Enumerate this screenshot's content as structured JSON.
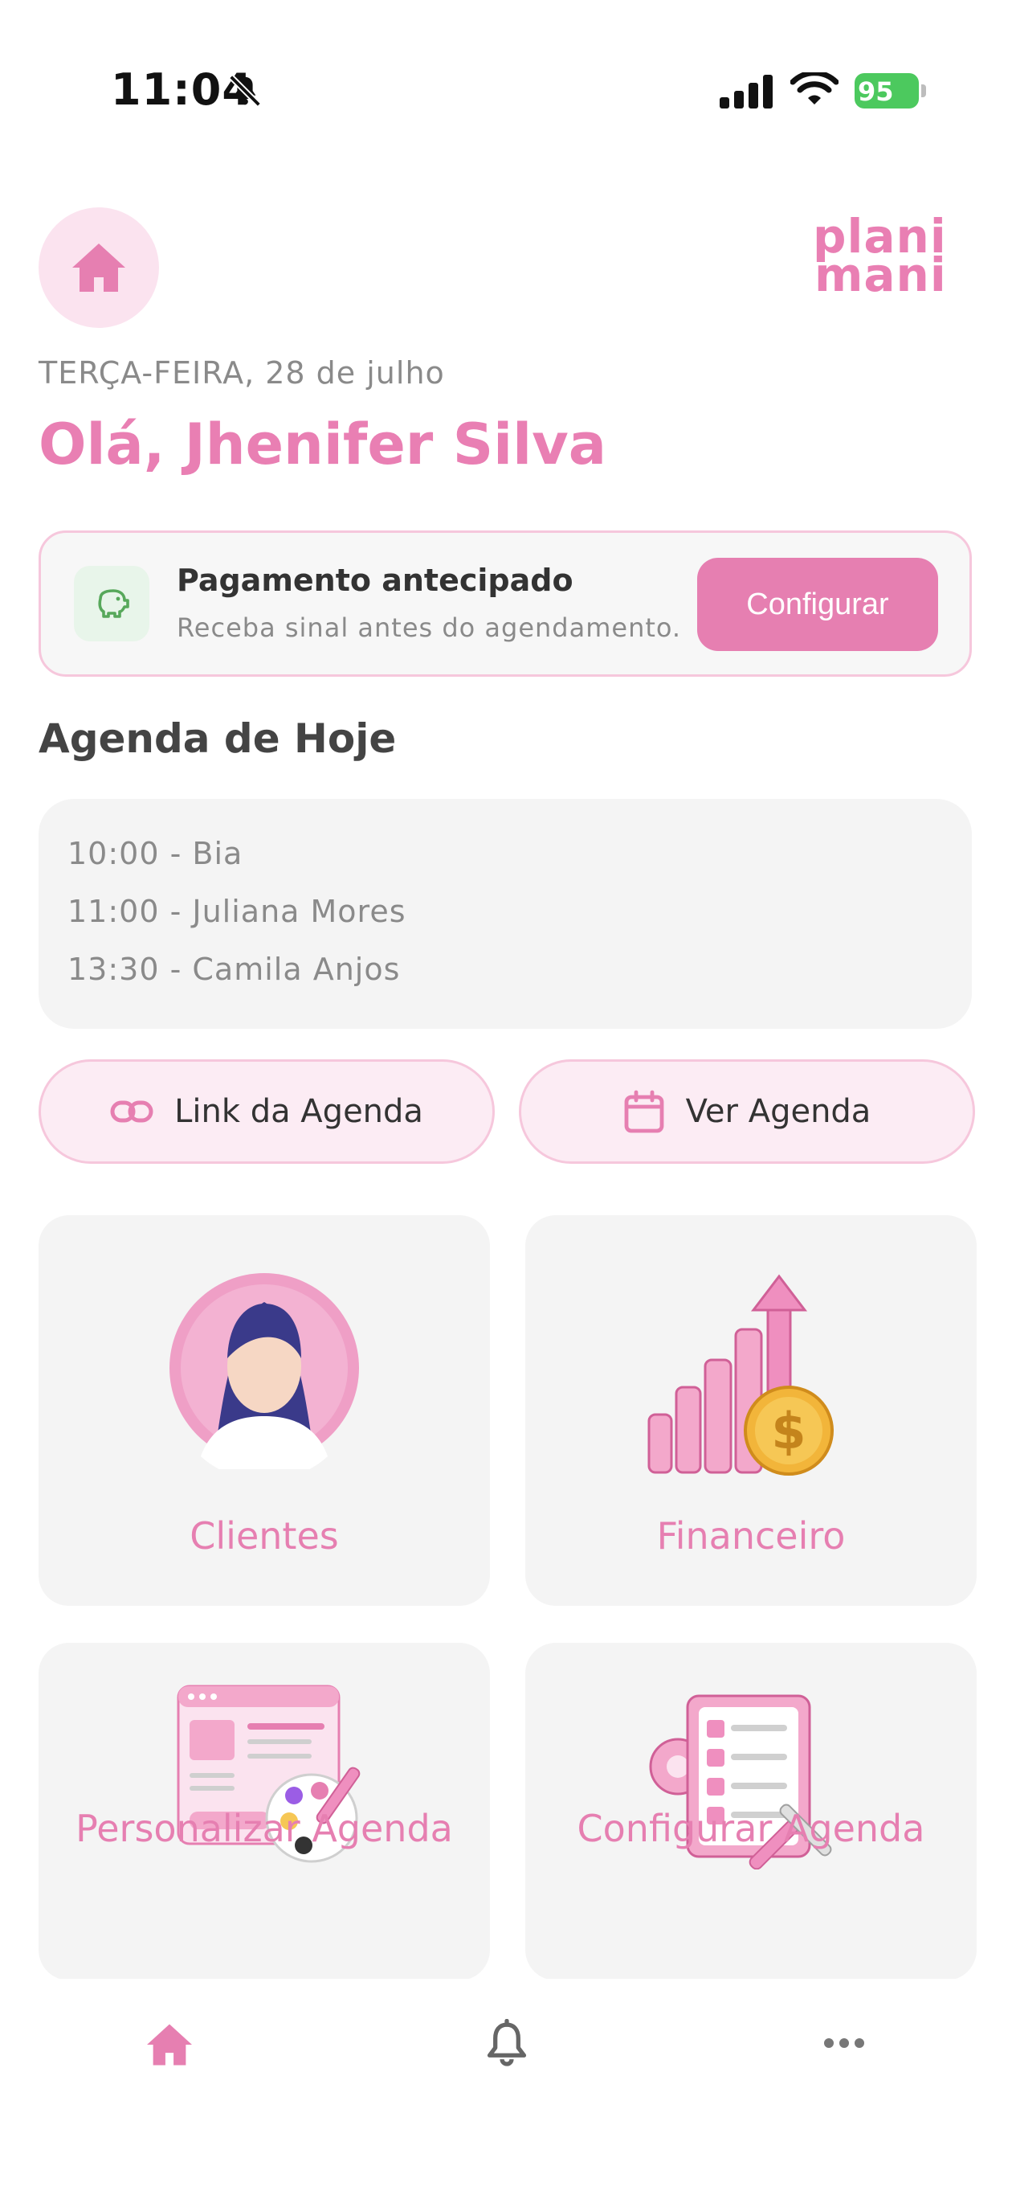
{
  "status_bar": {
    "time": "11:04",
    "battery": "95"
  },
  "header": {
    "logo_line1": "plani",
    "logo_line2": "mani",
    "date": "TERÇA-FEIRA, 28 de julho",
    "greeting": "Olá, Jhenifer Silva"
  },
  "payment_card": {
    "title": "Pagamento antecipado",
    "subtitle": "Receba sinal antes do agendamento.",
    "button": "Configurar"
  },
  "agenda": {
    "title": "Agenda de Hoje",
    "items": [
      "10:00 - Bia",
      "11:00 - Juliana Mores",
      "13:30 - Camila Anjos"
    ]
  },
  "actions": {
    "link_label": "Link da Agenda",
    "view_label": "Ver Agenda"
  },
  "tiles": {
    "clientes": "Clientes",
    "financeiro": "Financeiro",
    "personalizar": "Personalizar Agenda",
    "configurar": "Configurar Agenda"
  },
  "colors": {
    "accent": "#E67FB1",
    "accent_light": "#FBE3EF",
    "card_bg": "#F4F4F4",
    "battery_green": "#4CC95E"
  },
  "icons": {
    "nav_home": "home-icon",
    "nav_notifications": "bell-icon",
    "nav_more": "more-icon"
  }
}
